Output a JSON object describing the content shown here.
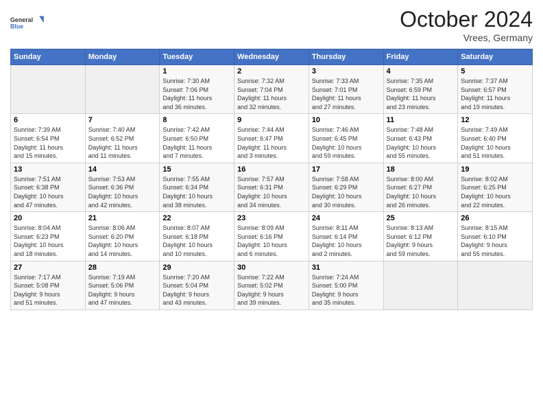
{
  "logo": {
    "line1": "General",
    "line2": "Blue"
  },
  "title": "October 2024",
  "location": "Vrees, Germany",
  "days_of_week": [
    "Sunday",
    "Monday",
    "Tuesday",
    "Wednesday",
    "Thursday",
    "Friday",
    "Saturday"
  ],
  "weeks": [
    [
      {
        "num": "",
        "detail": ""
      },
      {
        "num": "",
        "detail": ""
      },
      {
        "num": "1",
        "detail": "Sunrise: 7:30 AM\nSunset: 7:06 PM\nDaylight: 11 hours\nand 36 minutes."
      },
      {
        "num": "2",
        "detail": "Sunrise: 7:32 AM\nSunset: 7:04 PM\nDaylight: 11 hours\nand 32 minutes."
      },
      {
        "num": "3",
        "detail": "Sunrise: 7:33 AM\nSunset: 7:01 PM\nDaylight: 11 hours\nand 27 minutes."
      },
      {
        "num": "4",
        "detail": "Sunrise: 7:35 AM\nSunset: 6:59 PM\nDaylight: 11 hours\nand 23 minutes."
      },
      {
        "num": "5",
        "detail": "Sunrise: 7:37 AM\nSunset: 6:57 PM\nDaylight: 11 hours\nand 19 minutes."
      }
    ],
    [
      {
        "num": "6",
        "detail": "Sunrise: 7:39 AM\nSunset: 6:54 PM\nDaylight: 11 hours\nand 15 minutes."
      },
      {
        "num": "7",
        "detail": "Sunrise: 7:40 AM\nSunset: 6:52 PM\nDaylight: 11 hours\nand 11 minutes."
      },
      {
        "num": "8",
        "detail": "Sunrise: 7:42 AM\nSunset: 6:50 PM\nDaylight: 11 hours\nand 7 minutes."
      },
      {
        "num": "9",
        "detail": "Sunrise: 7:44 AM\nSunset: 6:47 PM\nDaylight: 11 hours\nand 3 minutes."
      },
      {
        "num": "10",
        "detail": "Sunrise: 7:46 AM\nSunset: 6:45 PM\nDaylight: 10 hours\nand 59 minutes."
      },
      {
        "num": "11",
        "detail": "Sunrise: 7:48 AM\nSunset: 6:43 PM\nDaylight: 10 hours\nand 55 minutes."
      },
      {
        "num": "12",
        "detail": "Sunrise: 7:49 AM\nSunset: 6:40 PM\nDaylight: 10 hours\nand 51 minutes."
      }
    ],
    [
      {
        "num": "13",
        "detail": "Sunrise: 7:51 AM\nSunset: 6:38 PM\nDaylight: 10 hours\nand 47 minutes."
      },
      {
        "num": "14",
        "detail": "Sunrise: 7:53 AM\nSunset: 6:36 PM\nDaylight: 10 hours\nand 42 minutes."
      },
      {
        "num": "15",
        "detail": "Sunrise: 7:55 AM\nSunset: 6:34 PM\nDaylight: 10 hours\nand 38 minutes."
      },
      {
        "num": "16",
        "detail": "Sunrise: 7:57 AM\nSunset: 6:31 PM\nDaylight: 10 hours\nand 34 minutes."
      },
      {
        "num": "17",
        "detail": "Sunrise: 7:58 AM\nSunset: 6:29 PM\nDaylight: 10 hours\nand 30 minutes."
      },
      {
        "num": "18",
        "detail": "Sunrise: 8:00 AM\nSunset: 6:27 PM\nDaylight: 10 hours\nand 26 minutes."
      },
      {
        "num": "19",
        "detail": "Sunrise: 8:02 AM\nSunset: 6:25 PM\nDaylight: 10 hours\nand 22 minutes."
      }
    ],
    [
      {
        "num": "20",
        "detail": "Sunrise: 8:04 AM\nSunset: 6:23 PM\nDaylight: 10 hours\nand 18 minutes."
      },
      {
        "num": "21",
        "detail": "Sunrise: 8:06 AM\nSunset: 6:20 PM\nDaylight: 10 hours\nand 14 minutes."
      },
      {
        "num": "22",
        "detail": "Sunrise: 8:07 AM\nSunset: 6:18 PM\nDaylight: 10 hours\nand 10 minutes."
      },
      {
        "num": "23",
        "detail": "Sunrise: 8:09 AM\nSunset: 6:16 PM\nDaylight: 10 hours\nand 6 minutes."
      },
      {
        "num": "24",
        "detail": "Sunrise: 8:11 AM\nSunset: 6:14 PM\nDaylight: 10 hours\nand 2 minutes."
      },
      {
        "num": "25",
        "detail": "Sunrise: 8:13 AM\nSunset: 6:12 PM\nDaylight: 9 hours\nand 59 minutes."
      },
      {
        "num": "26",
        "detail": "Sunrise: 8:15 AM\nSunset: 6:10 PM\nDaylight: 9 hours\nand 55 minutes."
      }
    ],
    [
      {
        "num": "27",
        "detail": "Sunrise: 7:17 AM\nSunset: 5:08 PM\nDaylight: 9 hours\nand 51 minutes."
      },
      {
        "num": "28",
        "detail": "Sunrise: 7:19 AM\nSunset: 5:06 PM\nDaylight: 9 hours\nand 47 minutes."
      },
      {
        "num": "29",
        "detail": "Sunrise: 7:20 AM\nSunset: 5:04 PM\nDaylight: 9 hours\nand 43 minutes."
      },
      {
        "num": "30",
        "detail": "Sunrise: 7:22 AM\nSunset: 5:02 PM\nDaylight: 9 hours\nand 39 minutes."
      },
      {
        "num": "31",
        "detail": "Sunrise: 7:24 AM\nSunset: 5:00 PM\nDaylight: 9 hours\nand 35 minutes."
      },
      {
        "num": "",
        "detail": ""
      },
      {
        "num": "",
        "detail": ""
      }
    ]
  ]
}
